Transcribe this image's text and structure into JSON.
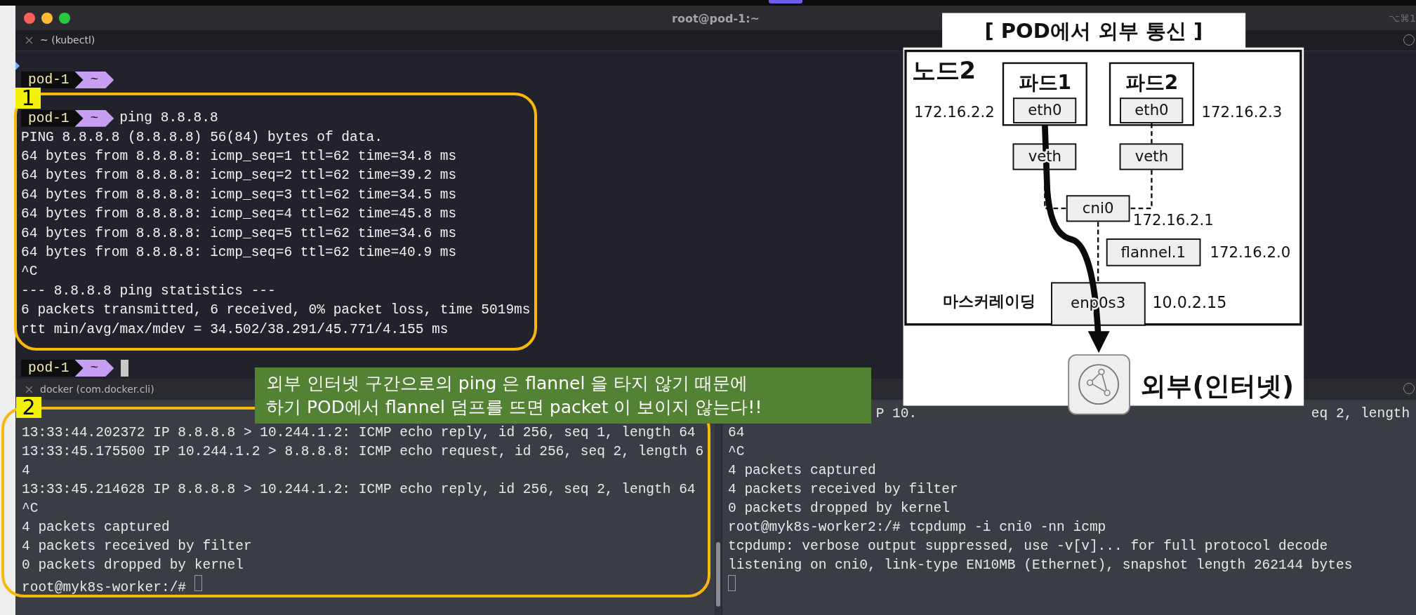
{
  "window": {
    "title": "root@pod-1:~",
    "shortcut": "⌥⌘1"
  },
  "top_pane": {
    "tab": "~ (kubectl)",
    "focused": true,
    "lines": [
      {
        "kind": "prompt",
        "host": "pod-1",
        "dir": "~"
      },
      {
        "kind": "prompt",
        "host": "pod-1",
        "dir": "~",
        "command": "ping 8.8.8.8"
      },
      {
        "kind": "output",
        "text": "PING 8.8.8.8 (8.8.8.8) 56(84) bytes of data."
      },
      {
        "kind": "output",
        "text": "64 bytes from 8.8.8.8: icmp_seq=1 ttl=62 time=34.8 ms"
      },
      {
        "kind": "output",
        "text": "64 bytes from 8.8.8.8: icmp_seq=2 ttl=62 time=39.2 ms"
      },
      {
        "kind": "output",
        "text": "64 bytes from 8.8.8.8: icmp_seq=3 ttl=62 time=34.5 ms"
      },
      {
        "kind": "output",
        "text": "64 bytes from 8.8.8.8: icmp_seq=4 ttl=62 time=45.8 ms"
      },
      {
        "kind": "output",
        "text": "64 bytes from 8.8.8.8: icmp_seq=5 ttl=62 time=34.6 ms"
      },
      {
        "kind": "output",
        "text": "64 bytes from 8.8.8.8: icmp_seq=6 ttl=62 time=40.9 ms"
      },
      {
        "kind": "output",
        "text": "^C"
      },
      {
        "kind": "output",
        "text": "--- 8.8.8.8 ping statistics ---"
      },
      {
        "kind": "output",
        "text": "6 packets transmitted, 6 received, 0% packet loss, time 5019ms"
      },
      {
        "kind": "output",
        "text": "rtt min/avg/max/mdev = 34.502/38.291/45.771/4.155 ms"
      },
      {
        "kind": "prompt",
        "host": "pod-1",
        "dir": "~",
        "cursor": true
      }
    ]
  },
  "bottom_tab": "docker (com.docker.cli)",
  "bottom_left": {
    "focused": false,
    "lines": [
      {
        "kind": "output",
        "text": "13:33:44.202372 IP 8.8.8.8 > 10.244.1.2: ICMP echo reply, id 256, seq 1, length 64"
      },
      {
        "kind": "output",
        "text": "13:33:45.175500 IP 10.244.1.2 > 8.8.8.8: ICMP echo request, id 256, seq 2, length 6"
      },
      {
        "kind": "output",
        "text": "4"
      },
      {
        "kind": "output",
        "text": "13:33:45.214628 IP 8.8.8.8 > 10.244.1.2: ICMP echo reply, id 256, seq 2, length 64"
      },
      {
        "kind": "output",
        "text": "^C"
      },
      {
        "kind": "output",
        "text": "4 packets captured"
      },
      {
        "kind": "output",
        "text": "4 packets received by filter"
      },
      {
        "kind": "output",
        "text": "0 packets dropped by kernel"
      },
      {
        "kind": "shell",
        "text": "root@myk8s-worker:/#",
        "cursor": true
      }
    ]
  },
  "bottom_right": {
    "focused": false,
    "lines": [
      {
        "kind": "fragments",
        "parts": [
          "P 10.",
          "eq 2, length"
        ]
      },
      {
        "kind": "output",
        "text": "64"
      },
      {
        "kind": "output",
        "text": "^C"
      },
      {
        "kind": "output",
        "text": "4 packets captured"
      },
      {
        "kind": "output",
        "text": "4 packets received by filter"
      },
      {
        "kind": "output",
        "text": "0 packets dropped by kernel"
      },
      {
        "kind": "output",
        "text": "root@myk8s-worker2:/# tcpdump -i cni0 -nn icmp"
      },
      {
        "kind": "output",
        "text": "tcpdump: verbose output suppressed, use -v[v]... for full protocol decode"
      },
      {
        "kind": "output",
        "text": "listening on cni0, link-type EN10MB (Ethernet), snapshot length 262144 bytes"
      },
      {
        "kind": "shell",
        "cursor": true
      }
    ]
  },
  "highlights": [
    {
      "label": "1"
    },
    {
      "label": "2"
    }
  ],
  "note": {
    "lines": [
      "외부 인터넷 구간으로의 ping 은 flannel 을 타지 않기 때문에",
      "하기 POD에서 flannel 덤프를 뜨면 packet 이 보이지 않는다!!"
    ]
  },
  "diagram": {
    "title": "[ POD에서 외부 통신 ]",
    "node": "노드2",
    "pods": [
      {
        "name": "파드1",
        "iface": "eth0",
        "ip": "172.16.2.2",
        "veth": "veth"
      },
      {
        "name": "파드2",
        "iface": "eth0",
        "ip": "172.16.2.3",
        "veth": "veth"
      }
    ],
    "bridge": {
      "name": "cni0",
      "ip": "172.16.2.1"
    },
    "flannel": {
      "name": "flannel.1",
      "ip": "172.16.2.0"
    },
    "nic": {
      "name": "enp0s3",
      "ip": "10.0.2.15",
      "label": "마스커레이딩"
    },
    "external": "외부(인터넷)"
  }
}
